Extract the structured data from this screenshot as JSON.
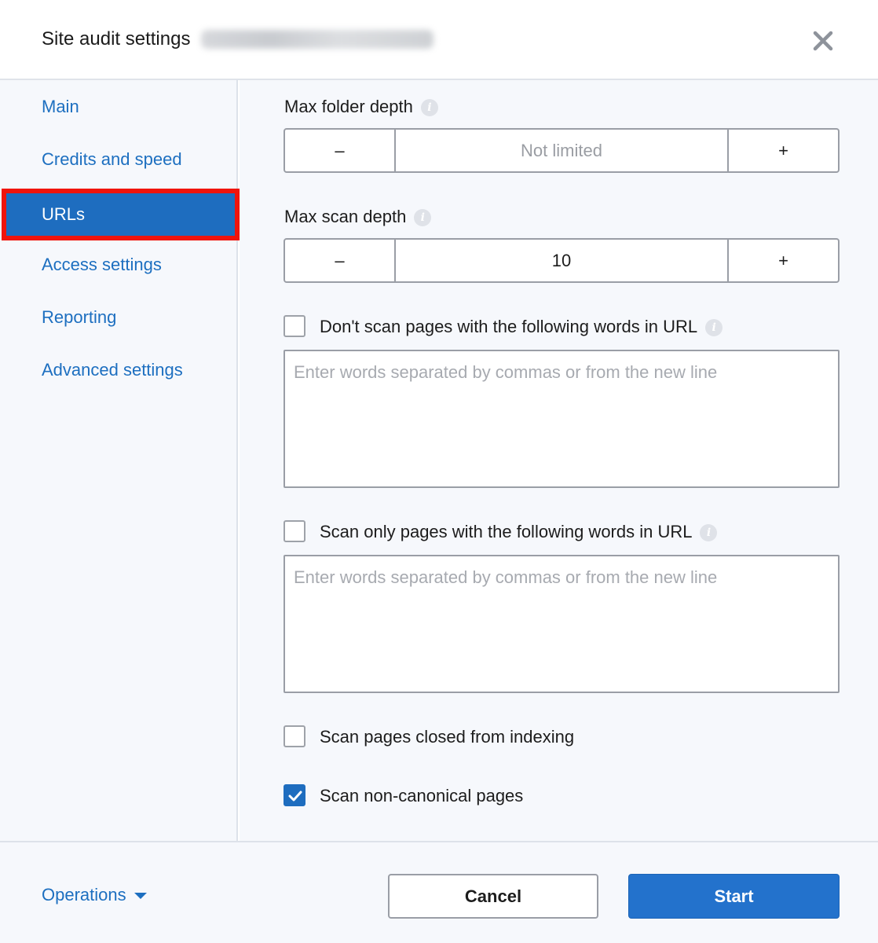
{
  "header": {
    "title": "Site audit settings",
    "close_icon": "close-icon"
  },
  "sidebar": {
    "items": [
      {
        "label": "Main",
        "active": false
      },
      {
        "label": "Credits and speed",
        "active": false
      },
      {
        "label": "URLs",
        "active": true
      },
      {
        "label": "Access settings",
        "active": false
      },
      {
        "label": "Reporting",
        "active": false
      },
      {
        "label": "Advanced settings",
        "active": false
      }
    ]
  },
  "main": {
    "max_folder_depth": {
      "label": "Max folder depth",
      "minus": "–",
      "plus": "+",
      "value": "",
      "placeholder": "Not limited"
    },
    "max_scan_depth": {
      "label": "Max scan depth",
      "minus": "–",
      "plus": "+",
      "value": "10"
    },
    "exclude_words": {
      "label": "Don't scan pages with the following words in URL",
      "checked": false,
      "placeholder": "Enter words separated by commas or from the new line"
    },
    "include_words": {
      "label": "Scan only pages with the following words in URL",
      "checked": false,
      "placeholder": "Enter words separated by commas or from the new line"
    },
    "scan_closed": {
      "label": "Scan pages closed from indexing",
      "checked": false
    },
    "scan_noncanonical": {
      "label": "Scan non-canonical pages",
      "checked": true
    }
  },
  "footer": {
    "operations_label": "Operations",
    "cancel_label": "Cancel",
    "start_label": "Start"
  },
  "colors": {
    "accent": "#1e6dbf",
    "highlight_border": "#f0140c",
    "link": "#1d6fc0"
  }
}
